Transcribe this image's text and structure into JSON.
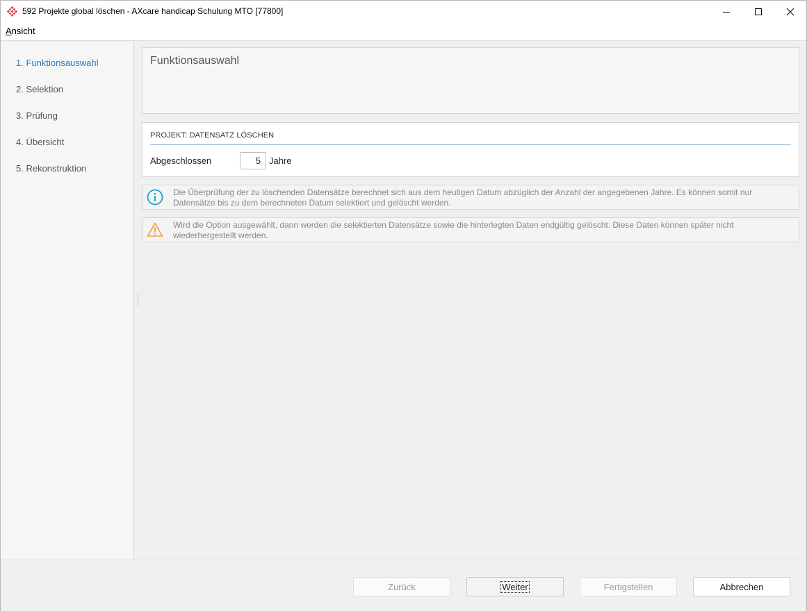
{
  "window": {
    "title": "592 Projekte global löschen - AXcare handicap Schulung MTO [77800]"
  },
  "menu": {
    "items": [
      {
        "label": "Ansicht",
        "mnemonic": "A"
      }
    ]
  },
  "sidebar": {
    "steps": [
      {
        "label": "1. Funktionsauswahl",
        "active": true
      },
      {
        "label": "2. Selektion",
        "active": false
      },
      {
        "label": "3. Prüfung",
        "active": false
      },
      {
        "label": "4. Übersicht",
        "active": false
      },
      {
        "label": "5. Rekonstruktion",
        "active": false
      }
    ]
  },
  "main": {
    "header_title": "Funktionsauswahl",
    "group": {
      "title": "PROJEKT: DATENSATZ LÖSCHEN",
      "field_label": "Abgeschlossen",
      "field_value": "5",
      "field_unit": "Jahre"
    },
    "info_message": "Die Überprüfung der zu löschenden Datensätze berechnet sich aus dem heutigen Datum abzüglich der Anzahl der angegebenen Jahre. Es können somit nur Datensätze bis zu dem berechneten Datum selektiert und gelöscht werden.",
    "warning_message": "Wird die Option ausgewählt, dann werden die selektierten Datensätze sowie die hinterlegten Daten endgültig gelöscht. Diese Daten können später nicht wiederhergestellt werden."
  },
  "footer": {
    "back_label": "Zurück",
    "next_label": "Weiter",
    "finish_label": "Fertigstellen",
    "cancel_label": "Abbrechen"
  },
  "colors": {
    "accent": "#2b79c2",
    "info": "#1aa7c4",
    "warning": "#f0a030",
    "app_icon": "#e0403a"
  }
}
